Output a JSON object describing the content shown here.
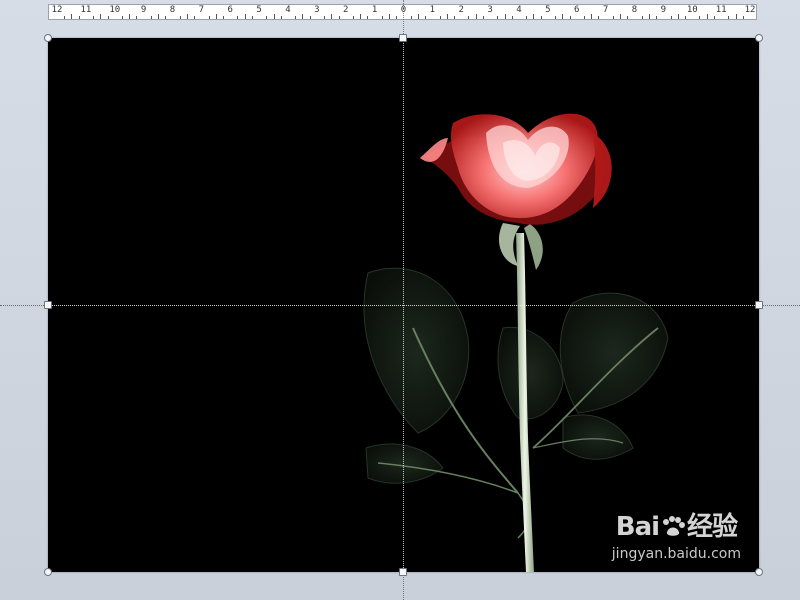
{
  "ruler": {
    "labels": [
      "12",
      "11",
      "10",
      "9",
      "8",
      "7",
      "6",
      "5",
      "4",
      "3",
      "2",
      "1",
      "0",
      "1",
      "2",
      "3",
      "4",
      "5",
      "6",
      "7",
      "8",
      "9",
      "10",
      "11",
      "12"
    ]
  },
  "slide": {
    "image_subject": "x-ray-rose"
  },
  "watermark": {
    "brand_left": "Bai",
    "brand_right": "经验",
    "url": "jingyan.baidu.com",
    "icon": "baidu-paw-icon"
  },
  "colors": {
    "slide_background": "#000000",
    "rose_petal": "#ff6b6b",
    "stem": "#dfe9d6"
  }
}
